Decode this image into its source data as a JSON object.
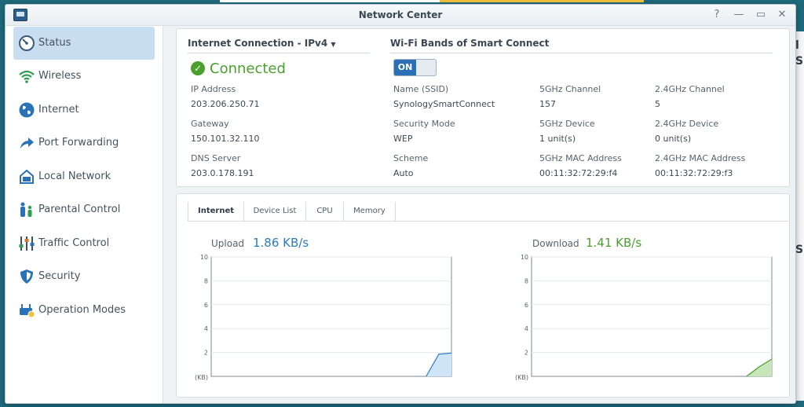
{
  "window": {
    "title": "Network Center"
  },
  "titlebar_controls": {
    "help": "?",
    "minimize": "—",
    "maximize": "▭",
    "close": "✕"
  },
  "sidebar": {
    "items": [
      {
        "label": "Status",
        "icon": "gauge-icon",
        "active": true
      },
      {
        "label": "Wireless",
        "icon": "wifi-icon"
      },
      {
        "label": "Internet",
        "icon": "globe-icon"
      },
      {
        "label": "Port Forwarding",
        "icon": "arrow-icon"
      },
      {
        "label": "Local Network",
        "icon": "local-network-icon"
      },
      {
        "label": "Parental Control",
        "icon": "family-icon"
      },
      {
        "label": "Traffic Control",
        "icon": "sliders-icon"
      },
      {
        "label": "Security",
        "icon": "shield-icon"
      },
      {
        "label": "Operation Modes",
        "icon": "router-icon"
      }
    ]
  },
  "internet": {
    "title": "Internet Connection - IPv4",
    "status": "Connected",
    "ip_label": "IP Address",
    "ip": "203.206.250.71",
    "gateway_label": "Gateway",
    "gateway": "150.101.32.110",
    "dns_label": "DNS Server",
    "dns": "203.0.178.191"
  },
  "wifi": {
    "title": "Wi-Fi Bands of Smart Connect",
    "toggle": "ON",
    "ssid_label": "Name (SSID)",
    "ssid": "SynologySmartConnect",
    "security_label": "Security Mode",
    "security": "WEP",
    "scheme_label": "Scheme",
    "scheme": "Auto",
    "ch5_label": "5GHz Channel",
    "ch5": "157",
    "dev5_label": "5GHz Device",
    "dev5": "1 unit(s)",
    "mac5_label": "5GHz MAC Address",
    "mac5": "00:11:32:72:29:f4",
    "ch24_label": "2.4GHz Channel",
    "ch24": "5",
    "dev24_label": "2.4GHz Device",
    "dev24": "0 unit(s)",
    "mac24_label": "2.4GHz MAC Address",
    "mac24": "00:11:32:72:29:f3"
  },
  "tabs": [
    {
      "label": "Internet",
      "active": true
    },
    {
      "label": "Device List"
    },
    {
      "label": "CPU"
    },
    {
      "label": "Memory"
    }
  ],
  "upload": {
    "label": "Upload",
    "value": "1.86 KB/s",
    "color": "#2b7bbf"
  },
  "download": {
    "label": "Download",
    "value": "1.41 KB/s",
    "color": "#4aa02c"
  },
  "chart_data": [
    {
      "type": "area",
      "title": "Upload",
      "ylabel": "(KB)",
      "ylim": [
        0,
        10
      ],
      "yticks": [
        2,
        4,
        6,
        8,
        10
      ],
      "x": [
        0,
        1,
        2,
        3,
        4,
        5,
        6,
        7,
        8,
        9,
        10,
        11,
        12,
        13,
        14,
        15,
        16,
        17,
        18,
        19
      ],
      "series": [
        {
          "values": [
            0,
            0,
            0,
            0,
            0,
            0,
            0,
            0,
            0,
            0,
            0,
            0,
            0,
            0,
            0,
            0,
            0,
            0,
            1.86,
            1.95
          ]
        }
      ],
      "color": "#2b7bbf",
      "fill": "#cfe4f7"
    },
    {
      "type": "area",
      "title": "Download",
      "ylabel": "(KB)",
      "ylim": [
        0,
        10
      ],
      "yticks": [
        2,
        4,
        6,
        8,
        10
      ],
      "x": [
        0,
        1,
        2,
        3,
        4,
        5,
        6,
        7,
        8,
        9,
        10,
        11,
        12,
        13,
        14,
        15,
        16,
        17,
        18,
        19
      ],
      "series": [
        {
          "values": [
            0,
            0,
            0,
            0,
            0,
            0,
            0,
            0,
            0,
            0,
            0,
            0,
            0,
            0,
            0,
            0,
            0,
            0,
            0.8,
            1.45
          ]
        }
      ],
      "color": "#4aa02c",
      "fill": "#c6e5b8"
    }
  ]
}
